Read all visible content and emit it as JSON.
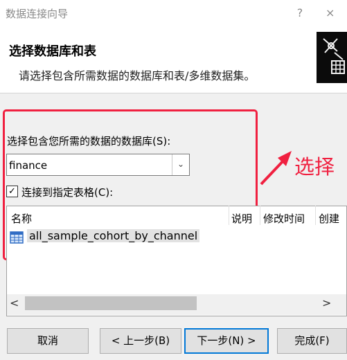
{
  "window": {
    "title": "数据连接向导",
    "help": "?",
    "close": "×"
  },
  "header": {
    "heading": "选择数据库和表",
    "subheading": "请选择包含所需数据的数据库和表/多维数据集。"
  },
  "database": {
    "label": "选择包含您所需的数据的数据库(S):",
    "value": "finance",
    "dropdown_icon": "chevron-down-icon"
  },
  "annotation": {
    "text": "选择",
    "color": "#f02040"
  },
  "connect_table": {
    "checked": true,
    "label": "连接到指定表格(C):"
  },
  "table": {
    "columns": [
      "名称",
      "说明",
      "修改时间",
      "创建"
    ],
    "rows": [
      {
        "name": "all_sample_cohort_by_channel",
        "icon": "table-icon"
      }
    ]
  },
  "scrollbar": {
    "left": "<",
    "right": ">"
  },
  "buttons": {
    "cancel": "取消",
    "back": "< 上一步(B)",
    "next": "下一步(N) >",
    "finish": "完成(F)"
  },
  "colors": {
    "accent": "#0078d7",
    "annotation": "#f02040"
  }
}
